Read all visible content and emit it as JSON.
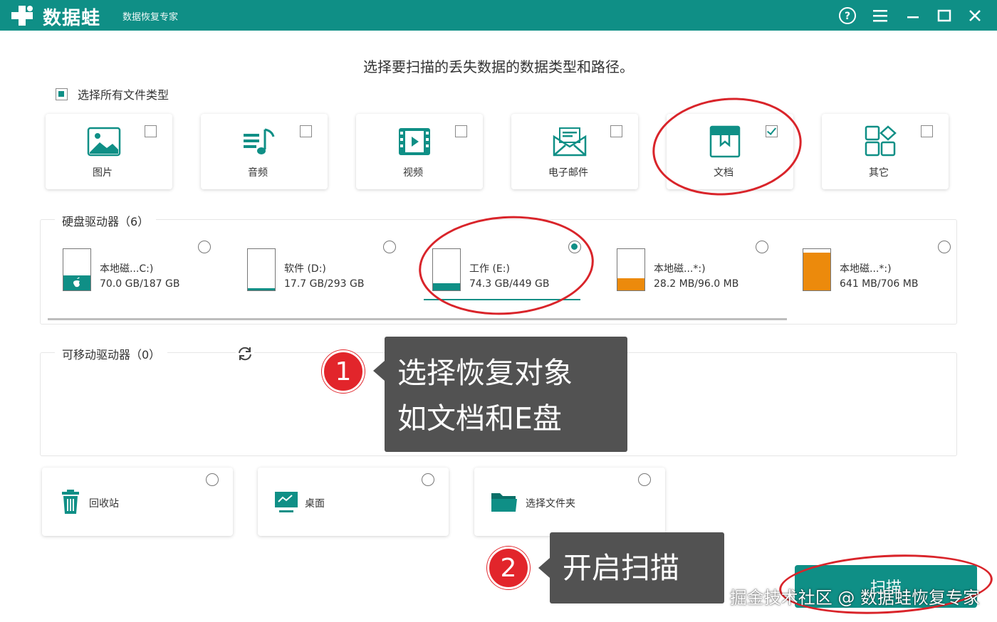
{
  "app": {
    "brand": "数据蛙",
    "subtitle": "数据恢复专家"
  },
  "heading": "选择要扫描的丢失数据的数据类型和路径。",
  "select_all_label": "选择所有文件类型",
  "file_types": [
    {
      "label": "图片",
      "icon": "image-icon",
      "checked": false
    },
    {
      "label": "音频",
      "icon": "audio-icon",
      "checked": false
    },
    {
      "label": "视频",
      "icon": "video-icon",
      "checked": false
    },
    {
      "label": "电子邮件",
      "icon": "email-icon",
      "checked": false
    },
    {
      "label": "文档",
      "icon": "document-icon",
      "checked": true
    },
    {
      "label": "其它",
      "icon": "other-icon",
      "checked": false
    }
  ],
  "drives_section": {
    "title": "硬盘驱动器（6）",
    "drives": [
      {
        "name": "本地磁...C:)",
        "size": "70.0 GB/187 GB",
        "used_fraction": 0.37,
        "color": "#0f8f86",
        "selected": false
      },
      {
        "name": "软件 (D:)",
        "size": "17.7 GB/293 GB",
        "used_fraction": 0.06,
        "color": "#0f8f86",
        "selected": false
      },
      {
        "name": "工作 (E:)",
        "size": "74.3 GB/449 GB",
        "used_fraction": 0.17,
        "color": "#0f8f86",
        "selected": true
      },
      {
        "name": "本地磁...*:)",
        "size": "28.2 MB/96.0 MB",
        "used_fraction": 0.29,
        "color": "#ec8a0c",
        "selected": false
      },
      {
        "name": "本地磁...*:)",
        "size": "641 MB/706 MB",
        "used_fraction": 0.91,
        "color": "#ec8a0c",
        "selected": false
      }
    ]
  },
  "removable_section": {
    "title": "可移动驱动器（0）"
  },
  "locations": [
    {
      "label": "回收站",
      "icon": "recycle-bin-icon"
    },
    {
      "label": "桌面",
      "icon": "desktop-icon"
    },
    {
      "label": "选择文件夹",
      "icon": "folder-icon"
    }
  ],
  "scan_button": "扫描",
  "callout1": {
    "number": "1",
    "line1": "选择恢复对象",
    "line2": "如文档和E盘"
  },
  "callout2": {
    "number": "2",
    "text": "开启扫描"
  },
  "watermark": "掘金技术社区 @ 数据蛙恢复专家",
  "colors": {
    "accent": "#0f8f86",
    "orange": "#ec8a0c",
    "annotation_red": "#d9242a"
  }
}
